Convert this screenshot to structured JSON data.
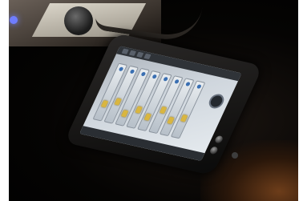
{
  "scene": {
    "subject": "handheld-touchscreen-controller"
  },
  "colors": {
    "screen": "#cfd6dd",
    "fader_cap": "#d9b640",
    "blue_led": "#6f7dff",
    "body": "#141312"
  },
  "device": {
    "channel_strip_count": 8
  }
}
